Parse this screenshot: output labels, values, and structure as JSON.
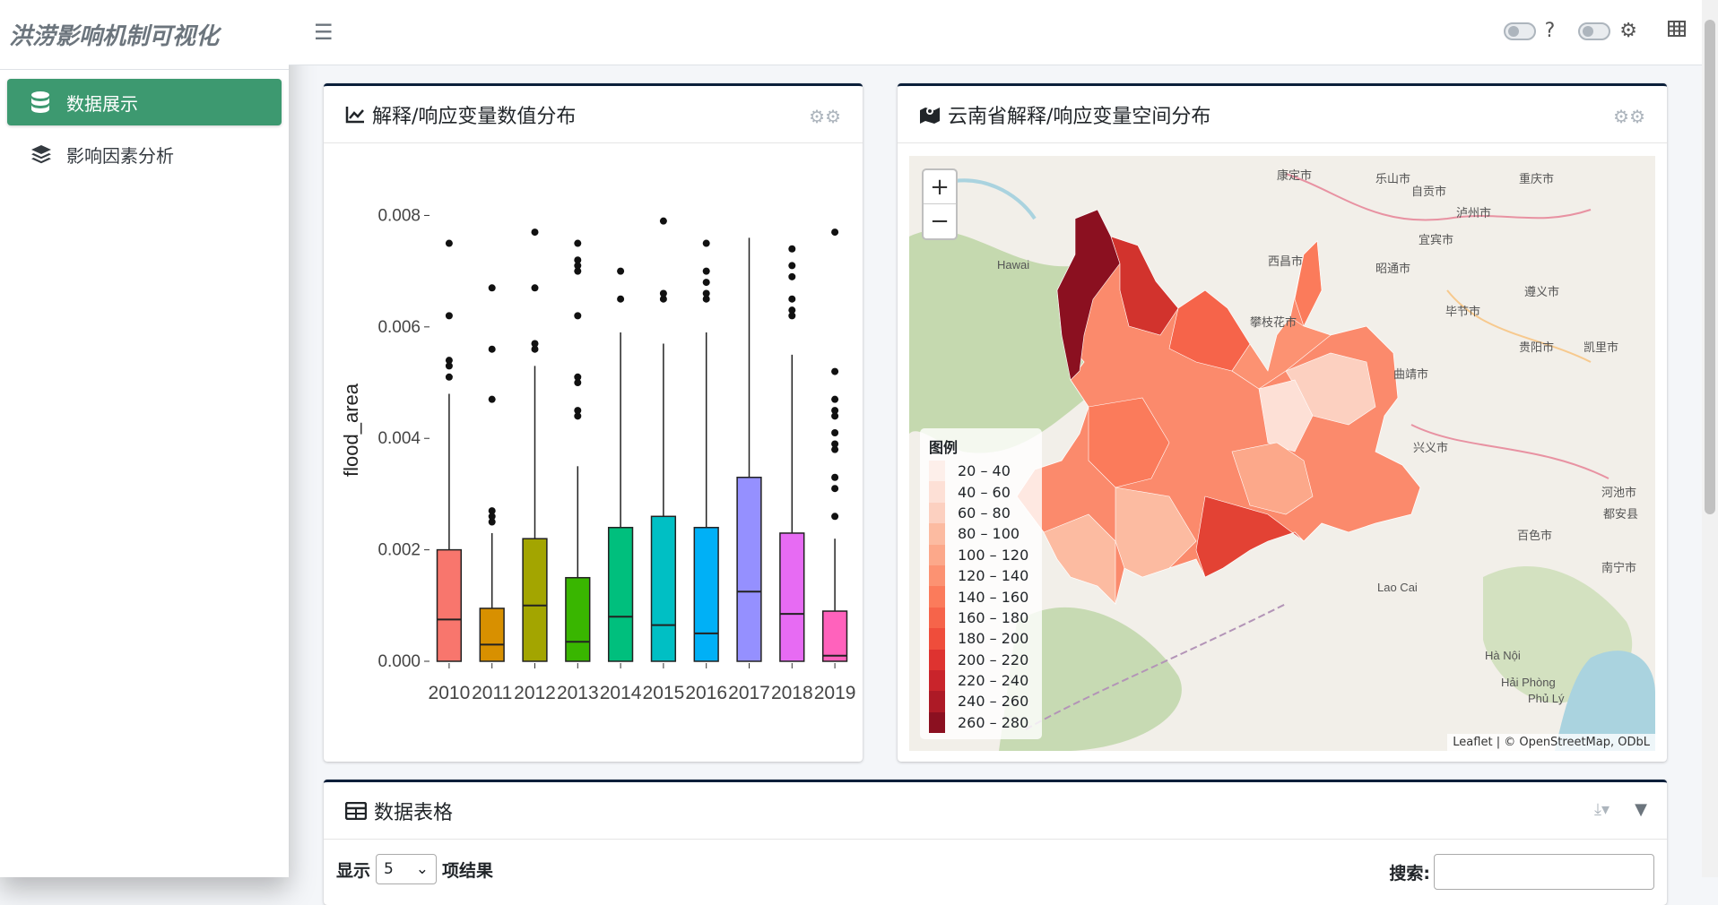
{
  "app": {
    "title": "洪涝影响机制可视化"
  },
  "sidebar": {
    "items": [
      {
        "label": "数据展示",
        "icon": "database-icon",
        "active": true
      },
      {
        "label": "影响因素分析",
        "icon": "layers-icon",
        "active": false
      }
    ]
  },
  "topbar": {
    "help": "?"
  },
  "boxplot_card": {
    "title": "解释/响应变量数值分布"
  },
  "map_card": {
    "title": "云南省解释/响应变量空间分布"
  },
  "table_card": {
    "title": "数据表格",
    "show_prefix": "显示",
    "show_value": "5",
    "show_suffix": "项结果",
    "search_label": "搜索:"
  },
  "map": {
    "zoom_in": "+",
    "zoom_out": "−",
    "attribution": "Leaflet | © OpenStreetMap, ODbL",
    "legend_title": "图例",
    "legend_items": [
      {
        "label": "20 – 40",
        "color": "#fdefea"
      },
      {
        "label": "40 – 60",
        "color": "#fde0d6"
      },
      {
        "label": "60 – 80",
        "color": "#fcd0c0"
      },
      {
        "label": "80 – 100",
        "color": "#fcbba1"
      },
      {
        "label": "100 – 120",
        "color": "#fca88a"
      },
      {
        "label": "120 – 140",
        "color": "#fc9272"
      },
      {
        "label": "140 – 160",
        "color": "#fb7b5b"
      },
      {
        "label": "160 – 180",
        "color": "#f6644a"
      },
      {
        "label": "180 – 200",
        "color": "#ef4d3b"
      },
      {
        "label": "200 – 220",
        "color": "#de3330"
      },
      {
        "label": "220 – 240",
        "color": "#c9242b"
      },
      {
        "label": "240 – 260",
        "color": "#ad1a26"
      },
      {
        "label": "260 – 280",
        "color": "#8b1020"
      }
    ],
    "place_labels": [
      "康定市",
      "乐山市",
      "自贡市",
      "重庆市",
      "泸州市",
      "西昌市",
      "宜宾市",
      "昭通市",
      "毕节市",
      "遵义市",
      "攀枝花市",
      "贵阳市",
      "凯里市",
      "曲靖市",
      "兴义市",
      "河池市",
      "都安县",
      "百色市",
      "南宁市",
      "Hà Nội",
      "Hải Phòng",
      "Hawai",
      "Lao Cai",
      "Phủ Lý"
    ]
  },
  "chart_data": {
    "type": "box",
    "ylabel": "flood_area",
    "ylim": [
      0,
      0.0082
    ],
    "yticks": [
      "0.000",
      "0.002",
      "0.004",
      "0.006",
      "0.008"
    ],
    "ytick_values": [
      0,
      0.002,
      0.004,
      0.006,
      0.008
    ],
    "categories": [
      "2010",
      "2011",
      "2012",
      "2013",
      "2014",
      "2015",
      "2016",
      "2017",
      "2018",
      "2019"
    ],
    "colors": [
      "#f8766d",
      "#d89000",
      "#a3a500",
      "#39b600",
      "#00bf7d",
      "#00bfc4",
      "#00b0f6",
      "#9590ff",
      "#e76bf3",
      "#ff62bc"
    ],
    "boxes": [
      {
        "low": 0,
        "q1": 0,
        "median": 0.00075,
        "q3": 0.002,
        "high": 0.0048,
        "outliers": [
          0.0051,
          0.0053,
          0.0054,
          0.0062,
          0.0075
        ]
      },
      {
        "low": 0,
        "q1": 0,
        "median": 0.0003,
        "q3": 0.00095,
        "high": 0.0023,
        "outliers": [
          0.0025,
          0.0026,
          0.0027,
          0.0047,
          0.0056,
          0.0067
        ]
      },
      {
        "low": 0,
        "q1": 0,
        "median": 0.001,
        "q3": 0.0022,
        "high": 0.0053,
        "outliers": [
          0.0056,
          0.0057,
          0.0067,
          0.0077
        ]
      },
      {
        "low": 0,
        "q1": 0,
        "median": 0.00035,
        "q3": 0.0015,
        "high": 0.0035,
        "outliers": [
          0.0044,
          0.0045,
          0.005,
          0.0051,
          0.0062,
          0.007,
          0.0071,
          0.0072,
          0.0075
        ]
      },
      {
        "low": 0,
        "q1": 0,
        "median": 0.0008,
        "q3": 0.0024,
        "high": 0.0059,
        "outliers": [
          0.0065,
          0.007
        ]
      },
      {
        "low": 0,
        "q1": 0,
        "median": 0.00065,
        "q3": 0.0026,
        "high": 0.0057,
        "outliers": [
          0.0065,
          0.0066,
          0.0079
        ]
      },
      {
        "low": 0,
        "q1": 0,
        "median": 0.0005,
        "q3": 0.0024,
        "high": 0.0059,
        "outliers": [
          0.0065,
          0.0066,
          0.0068,
          0.007,
          0.0075
        ]
      },
      {
        "low": 0,
        "q1": 0,
        "median": 0.00125,
        "q3": 0.0033,
        "high": 0.0076,
        "outliers": []
      },
      {
        "low": 0,
        "q1": 0,
        "median": 0.00085,
        "q3": 0.0023,
        "high": 0.0055,
        "outliers": [
          0.0062,
          0.0063,
          0.0065,
          0.0069,
          0.0071,
          0.0074
        ]
      },
      {
        "low": 0,
        "q1": 0,
        "median": 0.0001,
        "q3": 0.0009,
        "high": 0.0022,
        "outliers": [
          0.0026,
          0.0031,
          0.0033,
          0.0038,
          0.0039,
          0.0041,
          0.0044,
          0.0045,
          0.0047,
          0.0052,
          0.0077
        ]
      }
    ]
  }
}
